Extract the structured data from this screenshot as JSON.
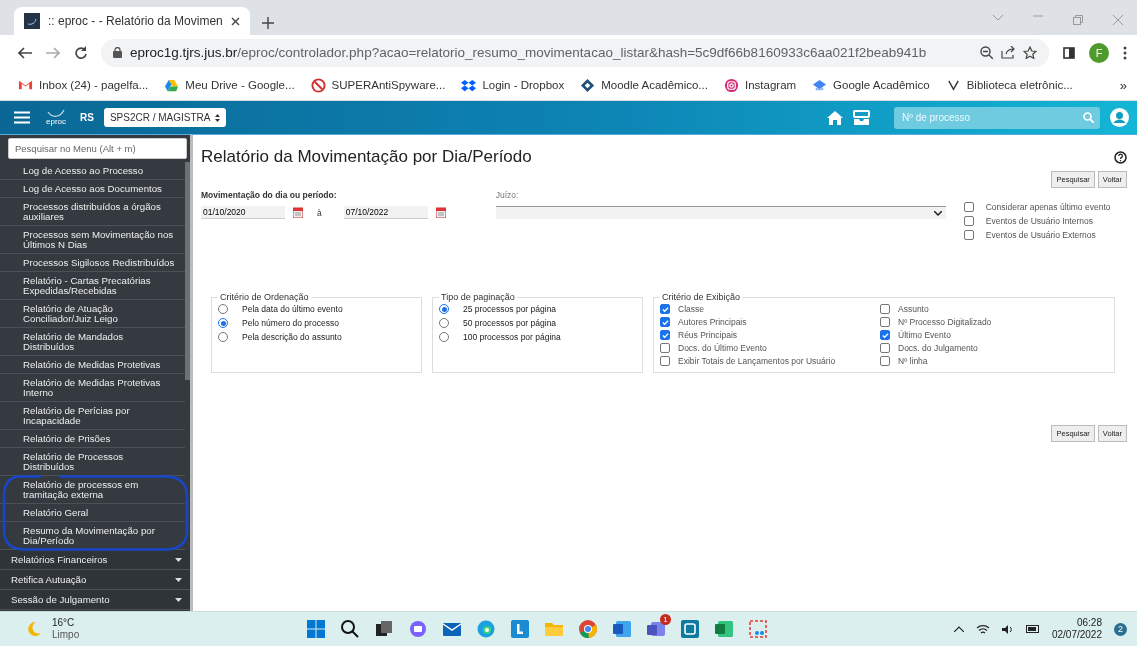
{
  "browser": {
    "tab": {
      "title": ":: eproc - - Relatório da Movimen"
    },
    "url": {
      "domain": "eproc1g.tjrs.jus.br",
      "path": "/eproc/controlador.php?acao=relatorio_resumo_movimentacao_listar&hash=5c9df66b8160933c6aa021f2beab941b"
    },
    "profile": "F",
    "bookmarks": [
      {
        "kind": "gmail",
        "label": "Inbox (24) - pagelfa..."
      },
      {
        "kind": "drive",
        "label": "Meu Drive - Google..."
      },
      {
        "kind": "shield",
        "label": "SUPERAntiSpyware..."
      },
      {
        "kind": "dropbox",
        "label": "Login - Dropbox"
      },
      {
        "kind": "moodle",
        "label": "Moodle Acadêmico..."
      },
      {
        "kind": "instagram",
        "label": "Instagram"
      },
      {
        "kind": "scholar",
        "label": "Google Acadêmico"
      },
      {
        "kind": "vmark",
        "label": "Biblioteca eletrônic..."
      }
    ],
    "more": "»"
  },
  "header": {
    "brand": "eproc",
    "state": "RS",
    "unit": "SPS2CR / MAGISTRA",
    "search_placeholder": "Nº de processo"
  },
  "sidebar": {
    "search_placeholder": "Pesquisar no Menu (Alt + m)",
    "items": [
      {
        "kind": "sub",
        "label": "Log de Acesso ao Processo"
      },
      {
        "kind": "sub",
        "label": "Log de Acesso aos Documentos"
      },
      {
        "kind": "sub",
        "label": "Processos distribuídos a órgãos auxiliares"
      },
      {
        "kind": "sub",
        "label": "Processos sem Movimentação nos Últimos N Dias"
      },
      {
        "kind": "sub",
        "label": "Processos Sigilosos Redistribuídos"
      },
      {
        "kind": "sub",
        "label": "Relatório - Cartas Precatórias Expedidas/Recebidas"
      },
      {
        "kind": "sub",
        "label": "Relatório de Atuação Conciliador/Juiz Leigo"
      },
      {
        "kind": "sub",
        "label": "Relatório de Mandados Distribuídos"
      },
      {
        "kind": "sub",
        "label": "Relatório de Medidas Protetivas"
      },
      {
        "kind": "sub",
        "label": "Relatório de Medidas Protetivas Interno"
      },
      {
        "kind": "sub",
        "label": "Relatório de Perícias por Incapacidade"
      },
      {
        "kind": "sub",
        "label": "Relatório de Prisões"
      },
      {
        "kind": "sub",
        "label": "Relatório de Processos Distribuídos"
      },
      {
        "kind": "sub",
        "label": "Relatório de processos em tramitação externa"
      },
      {
        "kind": "sub",
        "label": "Relatório Geral"
      },
      {
        "kind": "sub",
        "label": "Resumo da Movimentação por Dia/Período"
      },
      {
        "kind": "group",
        "label": "Relatórios Financeiros"
      },
      {
        "kind": "group",
        "label": "Retifica Autuação"
      },
      {
        "kind": "group",
        "label": "Sessão de Julgamento"
      }
    ]
  },
  "page": {
    "title": "Relatório da Movimentação por Dia/Período",
    "buttons_top": [
      "Pesquisar",
      "Voltar"
    ],
    "period": {
      "label": "Movimentação do dia ou período:",
      "from": "01/10/2020",
      "separator": "à",
      "to": "07/10/2022"
    },
    "juizo": {
      "label": "Juízo:"
    },
    "options": [
      {
        "label": "Considerar apenas último evento",
        "checked": false
      },
      {
        "label": "Eventos de Usuário Internos",
        "checked": false
      },
      {
        "label": "Eventos de Usuário Externos",
        "checked": false
      }
    ],
    "ordenacao": {
      "legend": "Critério de Ordenação",
      "options": [
        {
          "label": "Pela data do último evento",
          "selected": false
        },
        {
          "label": "Pelo número do processo",
          "selected": true
        },
        {
          "label": "Pela descrição do assunto",
          "selected": false
        }
      ]
    },
    "paginacao": {
      "legend": "Tipo de paginação",
      "options": [
        {
          "label": "25 processos por página",
          "selected": true
        },
        {
          "label": "50 processos por página",
          "selected": false
        },
        {
          "label": "100 processos por página",
          "selected": false
        }
      ]
    },
    "exibicao": {
      "legend": "Critério de Exibição",
      "columns": [
        [
          {
            "label": "Classe",
            "checked": true
          },
          {
            "label": "Autores Principais",
            "checked": true
          },
          {
            "label": "Réus Principais",
            "checked": true
          },
          {
            "label": "Docs. do Último Evento",
            "checked": false
          },
          {
            "label": "Exibir Totais de Lançamentos por Usuário",
            "checked": false
          }
        ],
        [
          {
            "label": "Assunto",
            "checked": false
          },
          {
            "label": "Nº Processo Digitalizado",
            "checked": false
          },
          {
            "label": "Último Evento",
            "checked": true
          },
          {
            "label": "Docs. do Julgamento",
            "checked": false
          },
          {
            "label": "Nº linha",
            "checked": false
          }
        ]
      ]
    },
    "buttons_bottom": [
      "Pesquisar",
      "Voltar"
    ]
  },
  "taskbar": {
    "temperature": "16°C",
    "condition": "Limpo",
    "apps": [
      {
        "kind": "windows"
      },
      {
        "kind": "search"
      },
      {
        "kind": "taskview"
      },
      {
        "kind": "chat"
      },
      {
        "kind": "mail"
      },
      {
        "kind": "edge"
      },
      {
        "kind": "bluesquare"
      },
      {
        "kind": "folder"
      },
      {
        "kind": "chrome"
      },
      {
        "kind": "word"
      },
      {
        "kind": "teams",
        "badge": "1"
      },
      {
        "kind": "photos"
      },
      {
        "kind": "excel"
      },
      {
        "kind": "snip"
      }
    ],
    "time": "06:28",
    "date": "02/07/2022",
    "notifications": "2"
  }
}
